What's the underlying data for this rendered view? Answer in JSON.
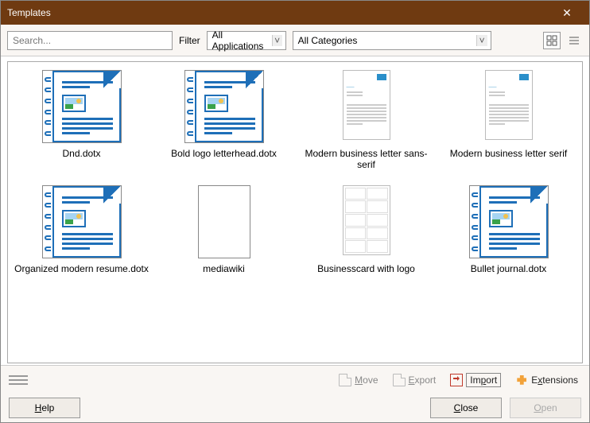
{
  "titlebar": {
    "title": "Templates"
  },
  "toolbar": {
    "search_placeholder": "Search...",
    "filter_label": "Filter",
    "app_dropdown": "All Applications",
    "cat_dropdown": "All Categories"
  },
  "templates": [
    {
      "label": "Dnd.dotx",
      "kind": "writer"
    },
    {
      "label": "Bold logo letterhead.dotx",
      "kind": "writer"
    },
    {
      "label": "Modern business letter sans-serif",
      "kind": "letter"
    },
    {
      "label": "Modern business letter serif",
      "kind": "letter-serif"
    },
    {
      "label": "Organized modern resume.dotx",
      "kind": "writer"
    },
    {
      "label": "mediawiki",
      "kind": "blank"
    },
    {
      "label": "Businesscard with logo",
      "kind": "bcard"
    },
    {
      "label": "Bullet journal.dotx",
      "kind": "writer"
    }
  ],
  "footer": {
    "move": "Move",
    "export": "Export",
    "import": "Import",
    "extensions": "Extensions",
    "help": "Help",
    "close": "Close",
    "open": "Open"
  }
}
